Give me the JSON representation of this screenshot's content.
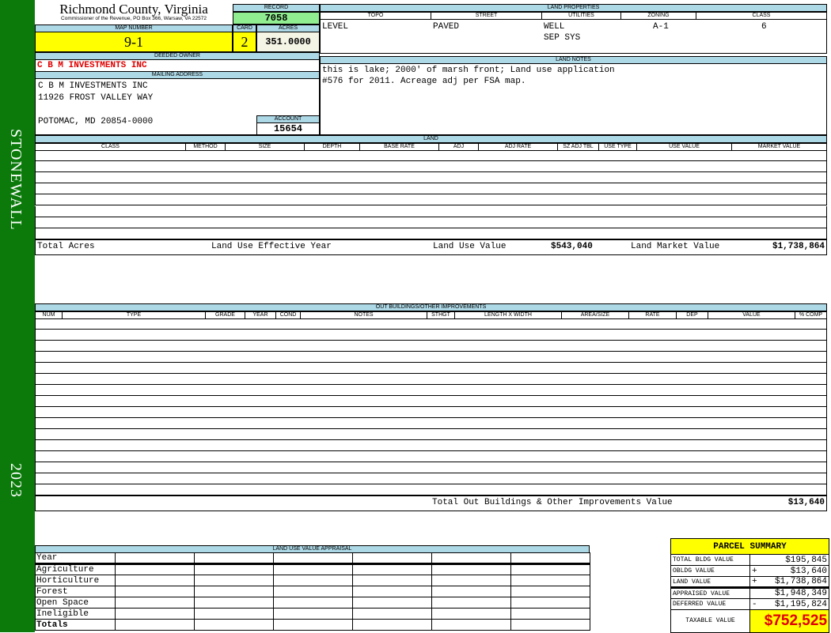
{
  "sidebar": {
    "district": "STONEWALL",
    "year": "2023",
    "color": "#0b7a0b"
  },
  "header": {
    "county": "Richmond County, Virginia",
    "office": "Commissioner of the Revenue, PO Box 366, Warsaw, VA 22572"
  },
  "record": {
    "label": "RECORD",
    "value": "7058"
  },
  "map": {
    "label": "MAP NUMBER",
    "value": "9-1"
  },
  "card": {
    "label": "CARD",
    "value": "2"
  },
  "acres": {
    "label": "ACRES",
    "value": "351.0000"
  },
  "owner": {
    "label": "DEEDED OWNER",
    "value": "C B M INVESTMENTS INC"
  },
  "mailing": {
    "label": "MAILING ADDRESS",
    "line1": "C B M INVESTMENTS INC",
    "line2": "11926 FROST VALLEY WAY",
    "line3": "POTOMAC, MD 20854-0000"
  },
  "account": {
    "label": "ACCOUNT",
    "value": "15654"
  },
  "land_properties": {
    "label": "LAND PROPERTIES",
    "headers": [
      "TOPO",
      "STREET",
      "UTILITIES",
      "ZONING",
      "CLASS"
    ],
    "values": [
      "LEVEL",
      "PAVED",
      "WELL\nSEP SYS",
      "A-1",
      "6"
    ]
  },
  "land_notes": {
    "label": "LAND NOTES",
    "text": "this is lake; 2000' of marsh front; Land use application\n#576 for 2011. Acreage adj per FSA map."
  },
  "land": {
    "label": "LAND",
    "headers": [
      "CLASS",
      "METHOD",
      "SIZE",
      "DEPTH",
      "BASE RATE",
      "ADJ",
      "ADJ RATE",
      "SZ ADJ TBL",
      "USE TYPE",
      "USE VALUE",
      "MARKET VALUE"
    ],
    "total_acres_label": "Total Acres",
    "effective_year_label": "Land Use Effective Year",
    "use_value_label": "Land Use Value",
    "use_value": "$543,040",
    "market_value_label": "Land Market Value",
    "market_value": "$1,738,864"
  },
  "outbuildings": {
    "label": "OUT BUILDINGS/OTHER IMPROVEMENTS",
    "headers": [
      "NUM",
      "TYPE",
      "GRADE",
      "YEAR",
      "COND",
      "NOTES",
      "STHGT",
      "LENGTH X WIDTH",
      "AREA/SIZE",
      "RATE",
      "DEP",
      "VALUE",
      "% COMP"
    ],
    "total_label": "Total Out Buildings & Other Improvements Value",
    "total_value": "$13,640"
  },
  "land_use": {
    "label": "LAND USE VALUE APPRAISAL",
    "year_label": "Year",
    "rows": [
      "Agriculture",
      "Horticulture",
      "Forest",
      "Open Space",
      "Ineligible"
    ],
    "totals_label": "Totals"
  },
  "parcel_summary": {
    "title": "PARCEL SUMMARY",
    "rows": [
      {
        "label": "TOTAL BLDG VALUE",
        "op": "",
        "value": "$195,845"
      },
      {
        "label": "OBLDG VALUE",
        "op": "+",
        "value": "$13,640"
      },
      {
        "label": "LAND VALUE",
        "op": "+",
        "value": "$1,738,864"
      },
      {
        "label": "APPRAISED VALUE",
        "op": "",
        "value": "$1,948,349"
      },
      {
        "label": "DEFERRED VALUE",
        "op": "-",
        "value": "$1,195,824"
      }
    ],
    "taxable_label": "TAXABLE VALUE",
    "taxable_value": "$752,525"
  }
}
